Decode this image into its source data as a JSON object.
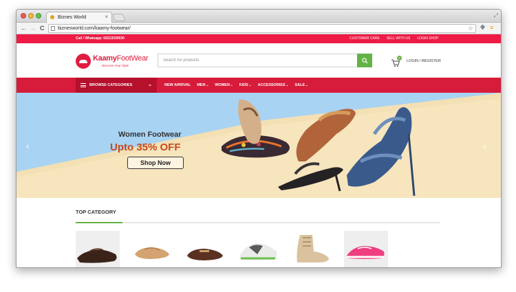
{
  "browser": {
    "tab_title": "Biznes World",
    "tab_close": "×",
    "url": "biznesworld.com/kaamy-footwear/",
    "back_glyph": "←",
    "forward_glyph": "→",
    "reload_glyph": "C",
    "bookmark_glyph": "☆",
    "menu_glyph": "≡",
    "resize_glyph": "⤢"
  },
  "site": {
    "topbar": {
      "contact": "Call / Whatsapp: 03213330030",
      "links": [
        "CUSTOMER CARE",
        "SELL WITH US",
        "LOGIN SHOP"
      ]
    },
    "logo": {
      "name_a": "Kaamy",
      "name_b": "FootWear",
      "tagline": "Discover Your Style"
    },
    "search": {
      "placeholder": "Search for products"
    },
    "cart": {
      "count": "0"
    },
    "login_label": "LOGIN / REGISTER",
    "nav": {
      "browse_label": "BROWSE CATEGORIES",
      "items": [
        {
          "label": "NEW ARRIVAL",
          "arrow": ""
        },
        {
          "label": "MEN",
          "arrow": "⌄"
        },
        {
          "label": "WOMEN",
          "arrow": "⌄"
        },
        {
          "label": "KIDS",
          "arrow": "⌄"
        },
        {
          "label": "ACCESSORIES",
          "arrow": "⌄"
        },
        {
          "label": "SALE",
          "arrow": "⌄"
        }
      ]
    },
    "banner": {
      "title": "Women Footwear",
      "offer": "Upto 35% OFF",
      "cta": "Shop Now",
      "prev_glyph": "‹",
      "next_glyph": "›"
    },
    "top_category": {
      "title": "TOP CATEGORY"
    }
  },
  "colors": {
    "brand_red": "#ed1b45",
    "nav_red": "#d71c3b",
    "accent_green": "#63b246"
  }
}
